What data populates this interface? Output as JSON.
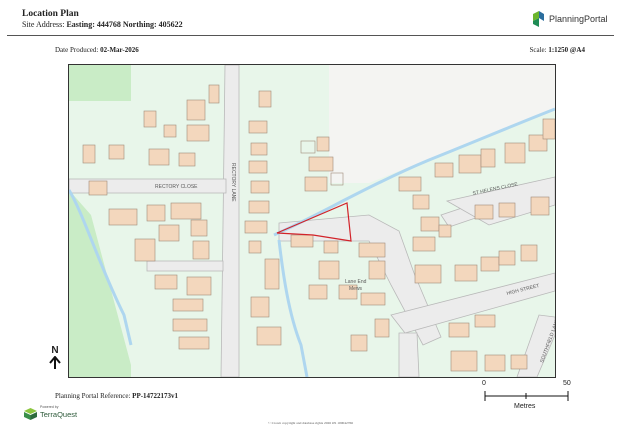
{
  "header": {
    "title": "Location Plan",
    "address_prefix": "Site Address: ",
    "address_value": "Easting: 444768 Northing: 405622",
    "logo_text": "PlanningPortal"
  },
  "meta": {
    "date_label": "Date Produced: ",
    "date_value": "02-Mar-2026",
    "scale_label": "Scale: ",
    "scale_value": "1:1250 @A4",
    "ref_label": "Planning Portal Reference: ",
    "ref_value": "PP-14722173v1"
  },
  "map": {
    "north": "N",
    "labels": {
      "rectory_lane": "RECTORY LANE",
      "rectory_close": "RECTORY CLOSE",
      "st_helens_close": "ST HELENS CLOSE",
      "high_street": "HIGH STREET",
      "lane_end_mews_1": "Lane End",
      "lane_end_mews_2": "Mews",
      "southfield_lane": "SOUTHFIELD LANE"
    },
    "colors": {
      "land": "#e8f6ea",
      "building": "#f3d7bd",
      "road": "#ececec",
      "water": "#aed6ef",
      "field": "#c9ecc6",
      "site_boundary": "#d2232a"
    }
  },
  "scale_bar": {
    "start": "0",
    "end": "50",
    "units": "Metres"
  },
  "footer": {
    "powered_by": "Powered by",
    "provider": "TerraQuest",
    "copyright": "© Crown copyright and database rights 2026 OS 100042766"
  }
}
